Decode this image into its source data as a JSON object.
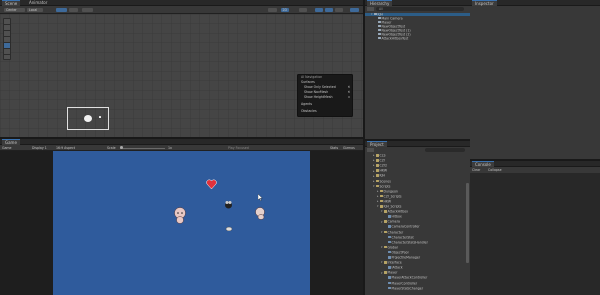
{
  "scene_tabs": [
    {
      "label": "Scene",
      "active": true
    },
    {
      "label": "Animator",
      "active": false
    }
  ],
  "scene_toolbar": {
    "center_label": "Center",
    "local_label": "Local",
    "mode_2d_label": "2D"
  },
  "navigation_overlay": {
    "title": "AI Navigation",
    "items": [
      {
        "label": "Surfaces",
        "has_checkbox": false
      },
      {
        "label": "Show Only Selected",
        "has_checkbox": true,
        "checked": true
      },
      {
        "label": "Show NavMesh",
        "has_checkbox": true,
        "checked": true
      },
      {
        "label": "Show HeightMesh",
        "has_checkbox": true,
        "checked": false
      },
      {
        "label": "Agents",
        "has_checkbox": false
      },
      {
        "label": "Obstacles",
        "has_checkbox": false
      }
    ]
  },
  "hierarchy": {
    "tab_label": "Hierarchy",
    "search_placeholder": "All",
    "items": [
      {
        "label": "KJH",
        "depth": 0,
        "expanded": true
      },
      {
        "label": "Main Camera",
        "depth": 1
      },
      {
        "label": "Player",
        "depth": 1
      },
      {
        "label": "NewObjectTest",
        "depth": 1
      },
      {
        "label": "NewObjectTest (1)",
        "depth": 1
      },
      {
        "label": "NewObjectTest (2)",
        "depth": 1
      },
      {
        "label": "AttackHitboxTest",
        "depth": 1
      }
    ]
  },
  "inspector": {
    "tab_label": "Inspector"
  },
  "game_tabs": [
    {
      "label": "Game",
      "active": true
    }
  ],
  "game_toolbar": {
    "mode_label": "Game",
    "display_label": "Display 1",
    "aspect_label": "16:9 Aspect",
    "scale_label": "Scale",
    "scale_value": "1x",
    "play_focused_label": "Play Focused",
    "stats_label": "Stats",
    "gizmos_label": "Gizmos"
  },
  "project": {
    "tab_label": "Project",
    "items": [
      {
        "label": "CLS",
        "depth": 0,
        "kind": "folder"
      },
      {
        "label": "CLY",
        "depth": 0,
        "kind": "folder"
      },
      {
        "label": "CLY2",
        "depth": 0,
        "kind": "folder"
      },
      {
        "label": "HKW",
        "depth": 0,
        "kind": "folder"
      },
      {
        "label": "KJH",
        "depth": 0,
        "kind": "folder"
      },
      {
        "label": "Scenes",
        "depth": 0,
        "kind": "folder"
      },
      {
        "label": "Scripts",
        "depth": 0,
        "kind": "folder",
        "expanded": true
      },
      {
        "label": "Dungeon",
        "depth": 1,
        "kind": "folder"
      },
      {
        "label": "CLY_Scripts",
        "depth": 1,
        "kind": "folder"
      },
      {
        "label": "HKW",
        "depth": 1,
        "kind": "folder"
      },
      {
        "label": "KJH_Scripts",
        "depth": 1,
        "kind": "folder",
        "expanded": true
      },
      {
        "label": "AttackHitbox",
        "depth": 2,
        "kind": "folder",
        "expanded": true
      },
      {
        "label": "Hitbox",
        "depth": 3,
        "kind": "script"
      },
      {
        "label": "Camera",
        "depth": 2,
        "kind": "folder",
        "expanded": true
      },
      {
        "label": "CameraController",
        "depth": 3,
        "kind": "script"
      },
      {
        "label": "Character",
        "depth": 2,
        "kind": "folder",
        "expanded": true
      },
      {
        "label": "CharacterStat",
        "depth": 3,
        "kind": "script"
      },
      {
        "label": "CharacterStatsHandler",
        "depth": 3,
        "kind": "script"
      },
      {
        "label": "Global",
        "depth": 2,
        "kind": "folder",
        "expanded": true
      },
      {
        "label": "ObjectPool",
        "depth": 3,
        "kind": "script"
      },
      {
        "label": "ProjectileManager",
        "depth": 3,
        "kind": "script"
      },
      {
        "label": "Interface",
        "depth": 2,
        "kind": "folder",
        "expanded": true
      },
      {
        "label": "IAttack",
        "depth": 3,
        "kind": "script"
      },
      {
        "label": "Player",
        "depth": 2,
        "kind": "folder",
        "expanded": true
      },
      {
        "label": "PlayerAttackController",
        "depth": 3,
        "kind": "script"
      },
      {
        "label": "PlayerController",
        "depth": 3,
        "kind": "script"
      },
      {
        "label": "PlayerStatsChanger",
        "depth": 3,
        "kind": "script"
      }
    ]
  },
  "console": {
    "tab_label": "Console",
    "clear_label": "Clear",
    "collapse_label": "Collapse"
  },
  "colors": {
    "game_background": "#2f5b9c",
    "accent": "#3a72b0"
  }
}
